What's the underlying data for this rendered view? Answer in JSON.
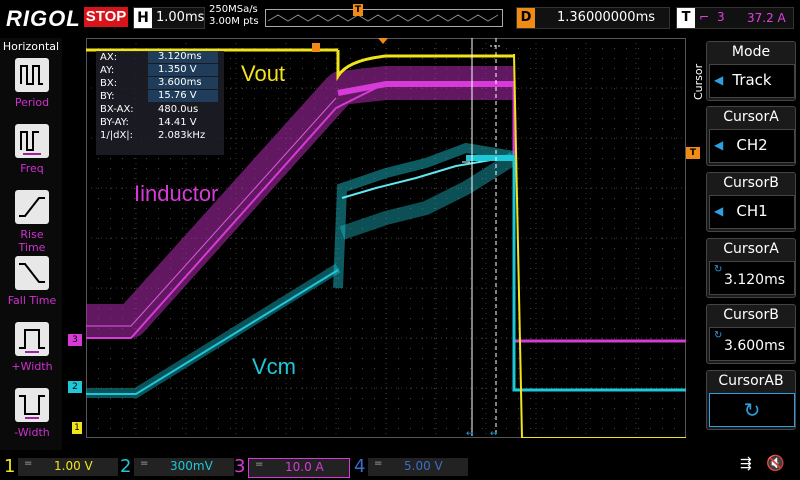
{
  "brand": "RIGOL",
  "run_state": "STOP",
  "horizontal": {
    "label": "H",
    "timebase": "1.00ms"
  },
  "sampling": {
    "rate": "250MSa/s",
    "points": "3.00M pts"
  },
  "trigger_marker": "T",
  "delay": {
    "label": "D",
    "value": "1.36000000ms"
  },
  "trigger": {
    "label": "T",
    "source": "3",
    "level": "37.2 A"
  },
  "left_panel": {
    "title": "Horizontal",
    "items": [
      {
        "label": "Period",
        "icon": "period-icon"
      },
      {
        "label": "Freq",
        "icon": "freq-icon"
      },
      {
        "label": "Rise Time",
        "icon": "rise-time-icon"
      },
      {
        "label": "Fall Time",
        "icon": "fall-time-icon"
      },
      {
        "label": "+Width",
        "icon": "plus-width-icon"
      },
      {
        "label": "-Width",
        "icon": "minus-width-icon"
      }
    ]
  },
  "cursor_readout": {
    "rows": [
      {
        "key": "AX:",
        "value": "3.120ms"
      },
      {
        "key": "AY:",
        "value": "1.350 V"
      },
      {
        "key": "BX:",
        "value": "3.600ms"
      },
      {
        "key": "BY:",
        "value": "15.76 V"
      },
      {
        "key": "BX-AX:",
        "value": "480.0us"
      },
      {
        "key": "BY-AY:",
        "value": "14.41 V"
      },
      {
        "key": "1/|dX|:",
        "value": "2.083kHz"
      }
    ]
  },
  "trace_labels": {
    "vout": "Vout",
    "iinductor": "Iinductor",
    "vcm": "Vcm"
  },
  "channel_markers": {
    "ch1": "1",
    "ch2": "2",
    "ch3": "3"
  },
  "right_panel": {
    "vertical_title": "Cursor",
    "mode": {
      "title": "Mode",
      "value": "Track"
    },
    "cursor_a_src": {
      "title": "CursorA",
      "value": "CH2"
    },
    "cursor_b_src": {
      "title": "CursorB",
      "value": "CH1"
    },
    "cursor_a_pos": {
      "title": "CursorA",
      "value": "3.120ms"
    },
    "cursor_b_pos": {
      "title": "CursorB",
      "value": "3.600ms"
    },
    "cursor_ab": {
      "title": "CursorAB",
      "icon": "rotate-icon"
    }
  },
  "channels": [
    {
      "num": "1",
      "coupling": "=",
      "scale": "1.00 V",
      "color": "#f2e41a"
    },
    {
      "num": "2",
      "coupling": "=",
      "scale": "300mV",
      "color": "#1ec8d8"
    },
    {
      "num": "3",
      "coupling": "=",
      "scale": "10.0 A",
      "color": "#d83ad8"
    },
    {
      "num": "4",
      "coupling": "=",
      "scale": "5.00 V",
      "color": "#3a6ec8"
    }
  ],
  "colors": {
    "ch1": "#f2e41a",
    "ch2": "#1ec8d8",
    "ch3": "#d83ad8",
    "ch4": "#3a6ec8",
    "accent": "#f08c16",
    "stop": "#d8141a"
  }
}
